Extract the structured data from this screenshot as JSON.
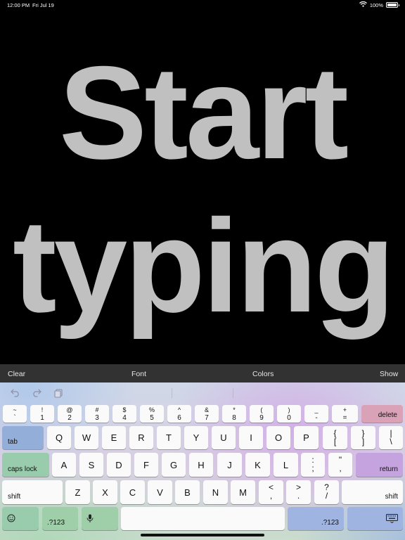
{
  "status_bar": {
    "time": "12:00 PM",
    "date": "Fri Jul 19",
    "battery": "100%",
    "battery_level": 1.0
  },
  "canvas": {
    "line1": "Start",
    "line2": "typing",
    "text_color": "#c0c0c0",
    "background": "#000000"
  },
  "toolbar": {
    "clear": "Clear",
    "font": "Font",
    "colors": "Colors",
    "show": "Show"
  },
  "keyboard": {
    "shortcuts": [
      "undo-icon",
      "redo-icon",
      "paste-icon"
    ],
    "number_row": [
      {
        "top": "~",
        "bottom": "`"
      },
      {
        "top": "!",
        "bottom": "1"
      },
      {
        "top": "@",
        "bottom": "2"
      },
      {
        "top": "#",
        "bottom": "3"
      },
      {
        "top": "$",
        "bottom": "4"
      },
      {
        "top": "%",
        "bottom": "5"
      },
      {
        "top": "^",
        "bottom": "6"
      },
      {
        "top": "&",
        "bottom": "7"
      },
      {
        "top": "*",
        "bottom": "8"
      },
      {
        "top": "(",
        "bottom": "9"
      },
      {
        "top": ")",
        "bottom": "0"
      },
      {
        "top": "_",
        "bottom": "-"
      },
      {
        "top": "+",
        "bottom": "="
      }
    ],
    "delete": "delete",
    "tab": "tab",
    "row_q": [
      "Q",
      "W",
      "E",
      "R",
      "T",
      "Y",
      "U",
      "I",
      "O",
      "P"
    ],
    "row_q_symbols": [
      {
        "top": "{",
        "bottom": "["
      },
      {
        "top": "}",
        "bottom": "]"
      },
      {
        "top": "|",
        "bottom": "\\"
      }
    ],
    "caps_lock": "caps lock",
    "row_a": [
      "A",
      "S",
      "D",
      "F",
      "G",
      "H",
      "J",
      "K",
      "L"
    ],
    "row_a_symbols": [
      {
        "top": ":",
        "bottom": ";"
      },
      {
        "top": "\"",
        "bottom": ","
      }
    ],
    "return": "return",
    "shift": "shift",
    "row_z": [
      "Z",
      "X",
      "C",
      "V",
      "B",
      "N",
      "M"
    ],
    "row_z_symbols": [
      {
        "top": "<",
        "bottom": ","
      },
      {
        "top": ">",
        "bottom": "."
      },
      {
        "top": "?",
        "bottom": "/"
      }
    ],
    "numbers_label": ".?123",
    "accent_colors": {
      "tab": "#93aed8",
      "delete": "#d9a2b6",
      "caps_lock": "#98ccac",
      "return": "#c5a3de"
    }
  }
}
